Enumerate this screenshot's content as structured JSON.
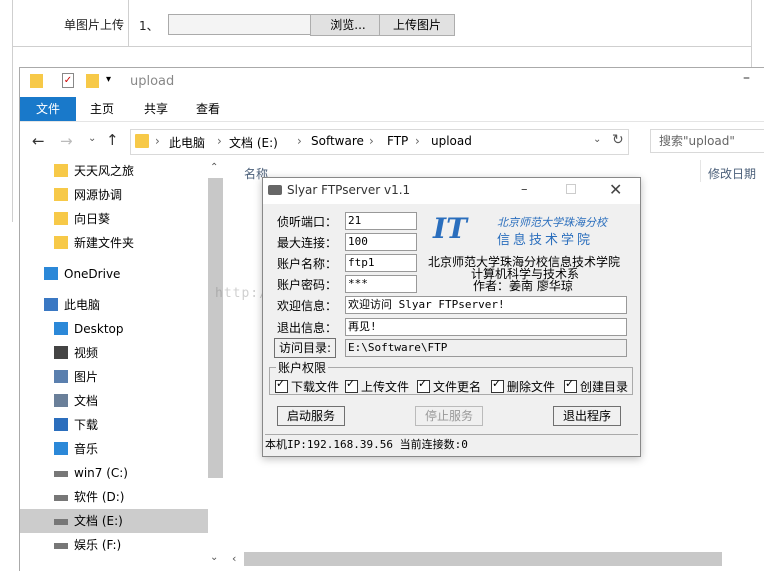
{
  "bg_form": {
    "label": "单图片上传",
    "prefix": "1、",
    "browse_label": "浏览...",
    "upload_label": "上传图片"
  },
  "explorer": {
    "title": "upload",
    "tabs": [
      "文件",
      "主页",
      "共享",
      "查看"
    ],
    "breadcrumb": [
      "此电脑",
      "文档 (E:)",
      "Software",
      "FTP",
      "upload"
    ],
    "search_placeholder": "搜索\"upload\"",
    "col_name": "名称",
    "col_modified": "修改日期",
    "nav_items": [
      {
        "label": "天天风之旅",
        "icon": "folder-icon"
      },
      {
        "label": "网源协调",
        "icon": "folder-icon"
      },
      {
        "label": "向日葵",
        "icon": "folder-icon"
      },
      {
        "label": "新建文件夹",
        "icon": "folder-icon"
      },
      {
        "label": "OneDrive",
        "icon": "cloud-icon"
      },
      {
        "label": "此电脑",
        "icon": "computer-icon"
      },
      {
        "label": "Desktop",
        "icon": "desktop-icon"
      },
      {
        "label": "视频",
        "icon": "video-icon"
      },
      {
        "label": "图片",
        "icon": "picture-icon"
      },
      {
        "label": "文档",
        "icon": "document-icon"
      },
      {
        "label": "下载",
        "icon": "download-icon"
      },
      {
        "label": "音乐",
        "icon": "music-icon"
      },
      {
        "label": "win7 (C:)",
        "icon": "drive-icon"
      },
      {
        "label": "软件 (D:)",
        "icon": "drive-icon"
      },
      {
        "label": "文档 (E:)",
        "icon": "drive-icon"
      },
      {
        "label": "娱乐 (F:)",
        "icon": "drive-icon"
      }
    ]
  },
  "ftp": {
    "title": "Slyar FTPserver v1.1",
    "fields": [
      {
        "label": "侦听端口：",
        "value": "21"
      },
      {
        "label": "最大连接：",
        "value": "100"
      },
      {
        "label": "账户名称：",
        "value": "ftp1"
      },
      {
        "label": "账户密码：",
        "value": "***"
      }
    ],
    "welcome_label": "欢迎信息：",
    "welcome_value": "欢迎访问 Slyar FTPserver!",
    "exit_label": "退出信息：",
    "exit_value": "再见!",
    "dir_button": "访问目录:",
    "dir_value": "E:\\Software\\FTP",
    "logo_cn": "北京师范大学珠海分校",
    "logo_sub": "信息技术学院",
    "school": "北京师范大学珠海分校信息技术学院",
    "dept": "计算机科学与技术系",
    "authors": "作者：姜南 廖华琼",
    "perm_group": "账户权限",
    "permissions": [
      "下载文件",
      "上传文件",
      "文件更名",
      "删除文件",
      "创建目录"
    ],
    "start_label": "启动服务",
    "stop_label": "停止服务",
    "quit_label": "退出程序",
    "status": "本机IP:192.168.39.56 当前连接数:0"
  },
  "colors": {
    "ribbon_file": "#1979ca",
    "logo_blue": "#2a6ebd"
  }
}
